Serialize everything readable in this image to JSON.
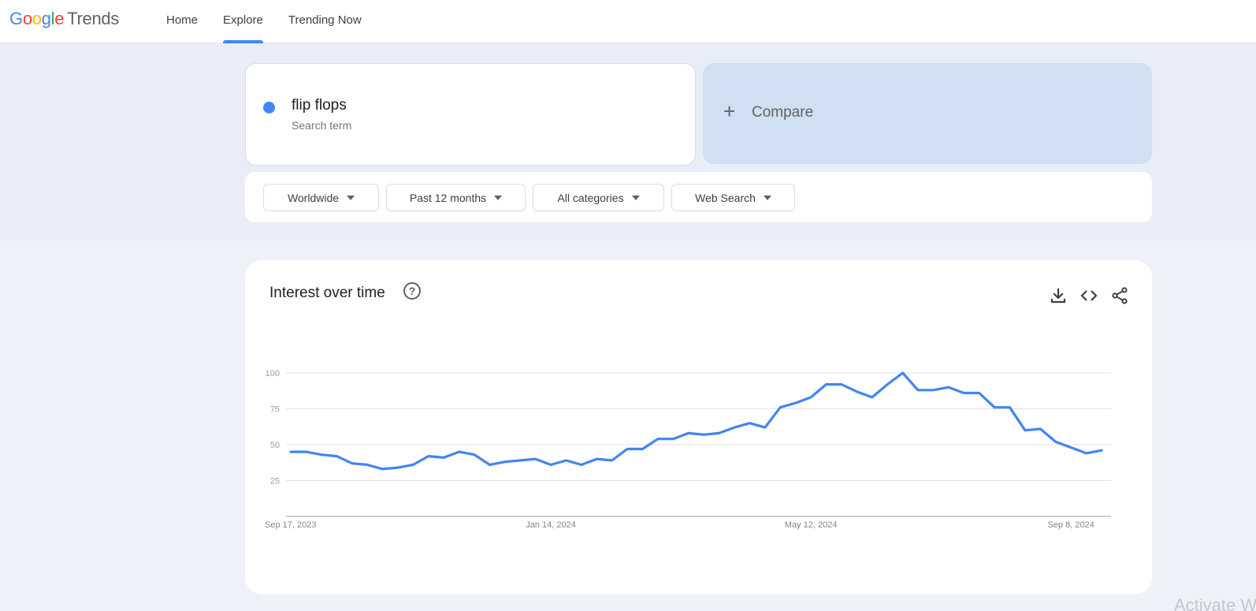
{
  "app": {
    "logo_letters": [
      "G",
      "o",
      "o",
      "g",
      "l",
      "e"
    ],
    "logo_suffix": "Trends"
  },
  "nav": {
    "items": [
      {
        "label": "Home",
        "active": false
      },
      {
        "label": "Explore",
        "active": true
      },
      {
        "label": "Trending Now",
        "active": false
      }
    ]
  },
  "search_term": {
    "name": "flip flops",
    "type": "Search term",
    "color": "#4285f4"
  },
  "compare": {
    "icon": "plus-icon",
    "label": "Compare"
  },
  "filters": [
    {
      "label": "Worldwide",
      "icon": "caret-down-icon"
    },
    {
      "label": "Past 12 months",
      "icon": "caret-down-icon"
    },
    {
      "label": "All categories",
      "icon": "caret-down-icon"
    },
    {
      "label": "Web Search",
      "icon": "caret-down-icon"
    }
  ],
  "chart_section": {
    "title": "Interest over time",
    "help_icon": "?",
    "tools": [
      "download-icon",
      "embed-code-icon",
      "share-icon"
    ]
  },
  "chart_data": {
    "type": "line",
    "title": "Interest over time",
    "xlabel": "",
    "ylabel": "",
    "ylim": [
      0,
      100
    ],
    "yticks": [
      25,
      50,
      75,
      100
    ],
    "grid": true,
    "x_tick_labels": [
      {
        "label": "Sep 17, 2023",
        "index": 0
      },
      {
        "label": "Jan 14, 2024",
        "index": 17
      },
      {
        "label": "May 12, 2024",
        "index": 34
      },
      {
        "label": "Sep 8, 2024",
        "index": 51
      }
    ],
    "series": [
      {
        "name": "flip flops",
        "color": "#4285f4",
        "values": [
          45,
          45,
          43,
          42,
          37,
          36,
          33,
          34,
          36,
          42,
          41,
          45,
          43,
          36,
          38,
          39,
          40,
          36,
          39,
          36,
          40,
          39,
          47,
          47,
          54,
          54,
          58,
          57,
          58,
          62,
          65,
          62,
          76,
          79,
          83,
          92,
          92,
          87,
          83,
          92,
          100,
          88,
          88,
          90,
          86,
          86,
          76,
          76,
          60,
          61,
          52,
          48,
          44,
          46
        ]
      }
    ]
  },
  "watermark": "Activate W"
}
